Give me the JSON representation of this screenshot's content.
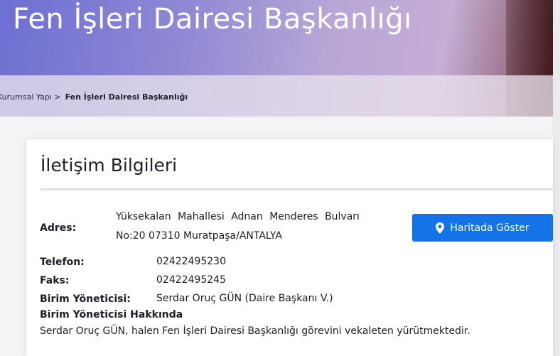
{
  "header": {
    "title": "Fen İşleri Dairesi Başkanlığı"
  },
  "breadcrumb": {
    "parent": "Kurumsal Yapı >",
    "current": "Fen İşleri Dairesi Başkanlığı"
  },
  "contact": {
    "heading": "İletişim Bilgileri",
    "address_label": "Adres:",
    "address_line1": "Yüksekalan Mahallesi Adnan Menderes Bulvarı",
    "address_line2": "No:20 07310 Muratpaşa/ANTALYA",
    "map_button_label": "Haritada Göster",
    "map_icon": "map-pin-icon",
    "phone_label": "Telefon:",
    "phone_value": "02422495230",
    "fax_label": "Faks:",
    "fax_value": "02422495245",
    "manager_label": "Birim Yöneticisi:",
    "manager_value": "Serdar Oruç GÜN (Daire Başkanı V.)",
    "about_heading": "Birim Yöneticisi Hakkında",
    "about_text": "Serdar Oruç GÜN, halen Fen İşleri Dairesi Başkanlığı görevini vekaleten yürütmektedir."
  },
  "colors": {
    "accent": "#1473e6",
    "text": "#1d1d29"
  }
}
